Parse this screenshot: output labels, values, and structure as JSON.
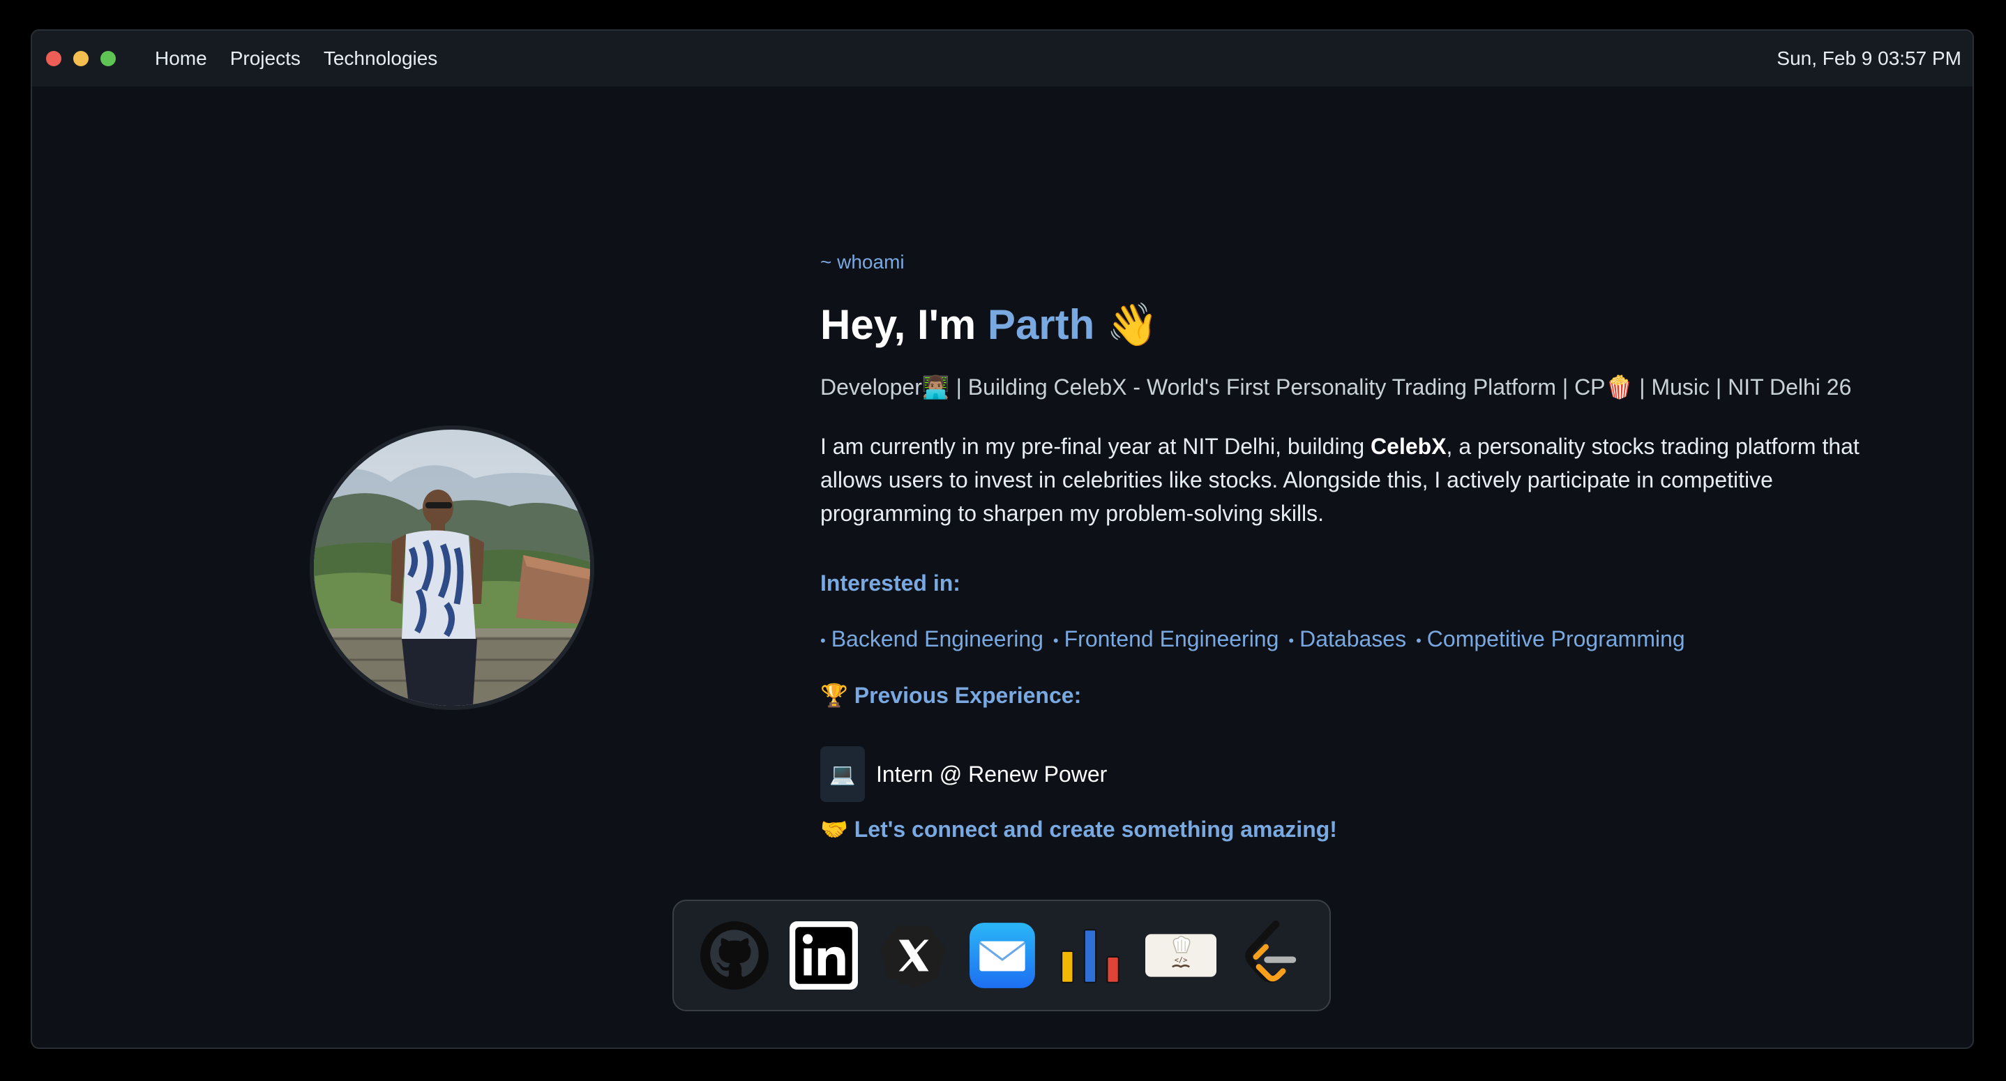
{
  "window": {
    "traffic_lights": [
      "close",
      "minimize",
      "maximize"
    ]
  },
  "menubar": {
    "nav": [
      {
        "label": "Home"
      },
      {
        "label": "Projects"
      },
      {
        "label": "Technologies"
      }
    ],
    "clock": "Sun, Feb 9 03:57 PM"
  },
  "profile": {
    "whoami": "~ whoami",
    "greeting": "Hey, I'm",
    "name": "Parth",
    "wave": "👋",
    "tagline": "Developer👨🏽‍💻 | Building CelebX - World's First Personality Trading Platform | CP🍿 | Music | NIT Delhi 26",
    "bio_before": "I am currently in my pre-final year at NIT Delhi, building ",
    "bio_bold": "CelebX",
    "bio_after": ", a personality stocks trading platform that allows users to invest in celebrities like stocks. Alongside this, I actively participate in competitive programming to sharpen my problem-solving skills.",
    "interest_title": "Interested in:",
    "interests": [
      "Backend Engineering",
      "Frontend Engineering",
      "Databases",
      "Competitive Programming"
    ],
    "exp_title": "🏆 Previous Experience:",
    "experience": [
      {
        "icon": "💻",
        "text": "Intern @ Renew Power"
      }
    ],
    "connect": "🤝 Let's connect and create something amazing!"
  },
  "dock": {
    "icons": [
      "github-icon",
      "linkedin-icon",
      "x-icon",
      "mail-icon",
      "stats-chart-icon",
      "codechef-icon",
      "leetcode-icon"
    ]
  },
  "colors": {
    "background": "#0d1117",
    "accent": "#79a9e0",
    "menubar": "#161b22"
  }
}
